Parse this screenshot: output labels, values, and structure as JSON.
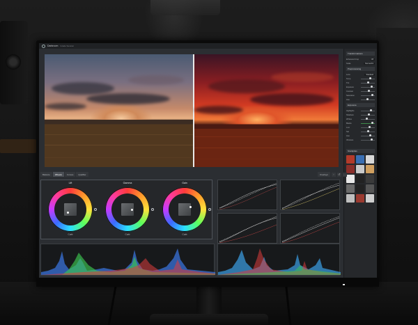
{
  "app": {
    "title": "Darkroom",
    "subtitle": "Grade Session"
  },
  "tabs": [
    {
      "label": "Balance",
      "active": false
    },
    {
      "label": "Wheels",
      "active": true
    },
    {
      "label": "Curves",
      "active": false
    },
    {
      "label": "Qualifier",
      "active": false
    }
  ],
  "toolbar": {
    "overlay_label": "Overlays"
  },
  "wheels": [
    {
      "title": "Lift",
      "footer": "Curb"
    },
    {
      "title": "Gamma",
      "footer": "Curb"
    },
    {
      "title": "Gain",
      "footer": "Curb"
    }
  ],
  "right_panel": {
    "sections": [
      {
        "title": "Transformations",
        "rows": [
          {
            "label": "Enhanced Crop",
            "value": "Off"
          },
          {
            "label": "Scale",
            "value": "Normal Fit"
          }
        ]
      },
      {
        "title": "Preprocessing",
        "rows": [
          {
            "label": "Lens",
            "value": "Standard"
          },
          {
            "label": "Temp",
            "value": ""
          },
          {
            "label": "Tint",
            "value": ""
          },
          {
            "label": "Exposure",
            "value": ""
          },
          {
            "label": "Contrast",
            "value": ""
          },
          {
            "label": "Saturation",
            "value": ""
          },
          {
            "label": "Hue",
            "value": ""
          }
        ]
      },
      {
        "title": "Exposure",
        "rows": [
          {
            "label": "Highlights",
            "value": ""
          },
          {
            "label": "Shadows",
            "value": ""
          },
          {
            "label": "Whites",
            "value": ""
          },
          {
            "label": "Blacks",
            "value": ""
          },
          {
            "label": "Lum",
            "value": ""
          },
          {
            "label": "Sat",
            "value": ""
          },
          {
            "label": "Hue",
            "value": ""
          },
          {
            "label": "Vibrance",
            "value": ""
          }
        ]
      },
      {
        "title": "Stockpiles",
        "rows": []
      }
    ],
    "thumb_colors": [
      "#b33a2a",
      "#3a6fb3",
      "#d8d8d8",
      "#8a2f2a",
      "#c9c9c9",
      "#d0a060",
      "#e9e9e9",
      "#222222",
      "#3a3a3a",
      "#6a6a6a",
      "#222",
      "#555",
      "#bfbfbf",
      "#9a3a30",
      "#cfcfcf"
    ]
  },
  "colors": {
    "accent": "#4a4e54",
    "split_line": "#e9e9e9"
  }
}
